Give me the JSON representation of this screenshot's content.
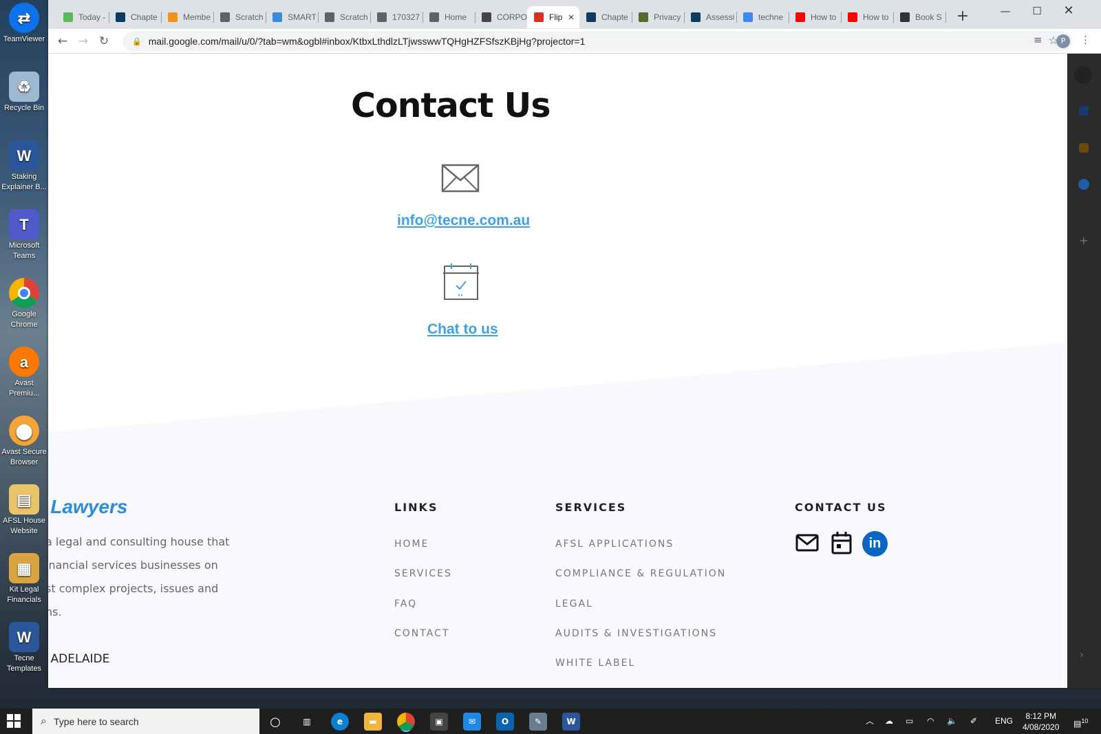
{
  "desktop": {
    "icons": [
      {
        "label": "TeamViewer",
        "color": "#0e72ed"
      },
      {
        "label": "Recycle Bin",
        "color": "#9fb8d0"
      },
      {
        "label": "Staking Explainer B...",
        "color": "#2b579a"
      },
      {
        "label": "Microsoft Teams",
        "color": "#5059c9"
      },
      {
        "label": "Google Chrome",
        "color": "#db4437"
      },
      {
        "label": "Avast Premiu...",
        "color": "#ff7800"
      },
      {
        "label": "Avast Secure Browser",
        "color": "#f3a536"
      },
      {
        "label": "AFSL House Website",
        "color": "#e8c36a"
      },
      {
        "label": "Kit Legal Financials",
        "color": "#d9a441"
      },
      {
        "label": "Tecne Templates",
        "color": "#2b579a"
      }
    ]
  },
  "browser": {
    "tabs": [
      {
        "label": "Today -",
        "fav": "#5cb85c"
      },
      {
        "label": "Chapte",
        "fav": "#0f3b60"
      },
      {
        "label": "Membe",
        "fav": "#f0901e"
      },
      {
        "label": "Scratch",
        "fav": "#5f6368"
      },
      {
        "label": "SMART",
        "fav": "#3b8ad9"
      },
      {
        "label": "Scratch",
        "fav": "#5f6368"
      },
      {
        "label": "170327",
        "fav": "#5f6368"
      },
      {
        "label": "Home",
        "fav": "#5f6368"
      },
      {
        "label": "CORPO",
        "fav": "#444444"
      },
      {
        "label": "Flip",
        "fav": "#d93025",
        "active": true
      },
      {
        "label": "Chapte",
        "fav": "#0f3b60"
      },
      {
        "label": "Privacy",
        "fav": "#556b2f"
      },
      {
        "label": "Assessi",
        "fav": "#0f3b60"
      },
      {
        "label": "techne",
        "fav": "#4285f4"
      },
      {
        "label": "How to",
        "fav": "#ff0000"
      },
      {
        "label": "How to",
        "fav": "#ff0000"
      },
      {
        "label": "Book S",
        "fav": "#333333"
      }
    ],
    "url": "mail.google.com/mail/u/0/?tab=wm&ogbl#inbox/KtbxLthdlzLTjwsswwTQHgHZFSfszKBjHg?projector=1",
    "profile_initial": "P"
  },
  "page": {
    "title": "Contact Us",
    "email": "info@tecne.com.au",
    "chat": "Chat to us",
    "footer": {
      "brand": "e Lawyers",
      "about_lines": [
        "a legal and consulting house that",
        "inancial services businesses on",
        "st complex projects, issues and",
        "ns."
      ],
      "city": "- ADELAIDE",
      "links_heading": "LINKS",
      "links": [
        "HOME",
        "SERVICES",
        "FAQ",
        "CONTACT"
      ],
      "services_heading": "SERVICES",
      "services": [
        "AFSL APPLICATIONS",
        "COMPLIANCE & REGULATION",
        "LEGAL",
        "AUDITS & INVESTIGATIONS",
        "WHITE LABEL"
      ],
      "contact_heading": "CONTACT US",
      "linkedin_label": "in"
    },
    "accent": "#3aa0ea"
  },
  "taskbar": {
    "search_placeholder": "Type here to search",
    "lang": "ENG",
    "time": "8:12 PM",
    "date": "4/08/2020",
    "notifications": "10"
  }
}
